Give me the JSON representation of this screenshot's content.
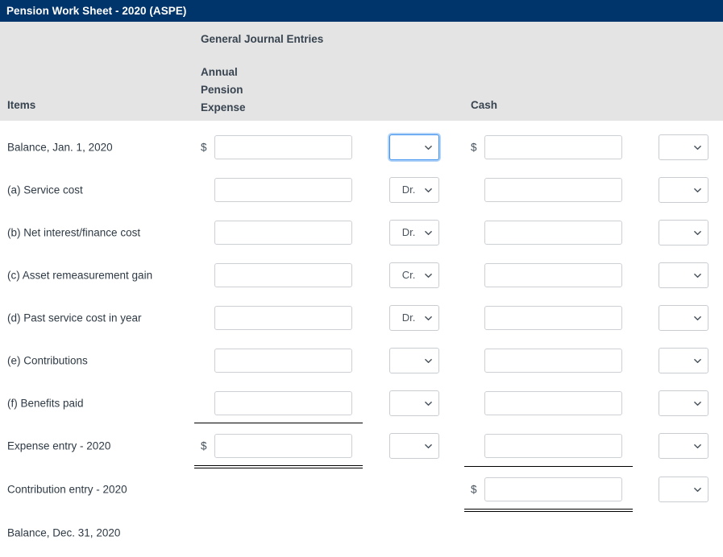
{
  "window": {
    "title": "Pension Work Sheet - 2020 (ASPE)",
    "titlebar_color": "#00356b",
    "header_band_color": "#e4e4e4"
  },
  "header": {
    "group_label": "General Journal Entries",
    "items_label": "Items",
    "expense_label_line1": "Annual",
    "expense_label_line2": "Pension",
    "expense_label_line3": "Expense",
    "cash_label": "Cash"
  },
  "symbols": {
    "dollar": "$"
  },
  "dropdown_options": [
    "",
    "Dr.",
    "Cr."
  ],
  "rows": [
    {
      "label": "Balance, Jan. 1, 2020",
      "expense_dollar": "$",
      "expense_value": "",
      "expense_drcr": "",
      "expense_drcr_focused": true,
      "cash_dollar": "$",
      "cash_value": "",
      "cash_drcr": ""
    },
    {
      "label": "(a) Service cost",
      "expense_dollar": "",
      "expense_value": "",
      "expense_drcr": "Dr.",
      "expense_drcr_focused": false,
      "cash_dollar": "",
      "cash_value": "",
      "cash_drcr": ""
    },
    {
      "label": "(b) Net interest/finance cost",
      "expense_dollar": "",
      "expense_value": "",
      "expense_drcr": "Dr.",
      "expense_drcr_focused": false,
      "cash_dollar": "",
      "cash_value": "",
      "cash_drcr": ""
    },
    {
      "label": "(c) Asset remeasurement gain",
      "expense_dollar": "",
      "expense_value": "",
      "expense_drcr": "Cr.",
      "expense_drcr_focused": false,
      "cash_dollar": "",
      "cash_value": "",
      "cash_drcr": ""
    },
    {
      "label": "(d) Past service cost in year",
      "expense_dollar": "",
      "expense_value": "",
      "expense_drcr": "Dr.",
      "expense_drcr_focused": false,
      "cash_dollar": "",
      "cash_value": "",
      "cash_drcr": ""
    },
    {
      "label": "(e) Contributions",
      "expense_dollar": "",
      "expense_value": "",
      "expense_drcr": "",
      "expense_drcr_focused": false,
      "cash_dollar": "",
      "cash_value": "",
      "cash_drcr": ""
    },
    {
      "label": "(f) Benefits paid",
      "expense_dollar": "",
      "expense_value": "",
      "expense_drcr": "",
      "expense_drcr_focused": false,
      "cash_dollar": "",
      "cash_value": "",
      "cash_drcr": ""
    },
    {
      "label": "Expense entry - 2020",
      "expense_dollar": "$",
      "expense_value": "",
      "expense_drcr": "",
      "expense_drcr_focused": false,
      "cash_dollar": "",
      "cash_value": "",
      "cash_drcr": ""
    },
    {
      "label": "Contribution entry - 2020",
      "expense_dollar": "",
      "expense_value": null,
      "expense_drcr": null,
      "expense_drcr_focused": false,
      "cash_dollar": "$",
      "cash_value": "",
      "cash_drcr": ""
    },
    {
      "label": "Balance, Dec. 31, 2020",
      "expense_dollar": "",
      "expense_value": null,
      "expense_drcr": null,
      "expense_drcr_focused": false,
      "cash_dollar": "",
      "cash_value": null,
      "cash_drcr": null
    }
  ]
}
